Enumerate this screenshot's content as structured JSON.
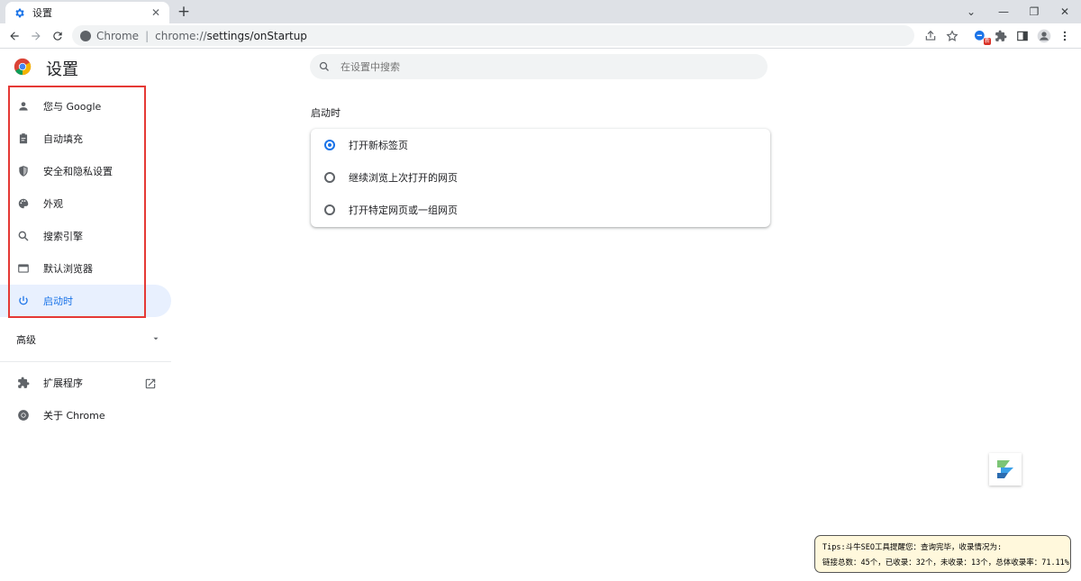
{
  "browser": {
    "tab_title": "设置",
    "omnibox": {
      "site_label": "Chrome",
      "separator": "|",
      "url_scheme": "chrome://",
      "url_path": "settings/onStartup"
    },
    "window_controls": {
      "dropdown": "⌄",
      "minimize": "—",
      "restore": "❐",
      "close": "✕"
    },
    "extension_badge": "新"
  },
  "settings": {
    "title": "设置",
    "search_placeholder": "在设置中搜索",
    "sidebar": {
      "items": [
        {
          "label": "您与 Google",
          "icon": "person-icon"
        },
        {
          "label": "自动填充",
          "icon": "clipboard-icon"
        },
        {
          "label": "安全和隐私设置",
          "icon": "shield-icon"
        },
        {
          "label": "外观",
          "icon": "palette-icon"
        },
        {
          "label": "搜索引擎",
          "icon": "search-icon"
        },
        {
          "label": "默认浏览器",
          "icon": "browser-window-icon"
        },
        {
          "label": "启动时",
          "icon": "power-icon",
          "selected": true
        }
      ],
      "advanced_label": "高级",
      "extensions_label": "扩展程序",
      "about_label": "关于 Chrome"
    },
    "startup": {
      "section_title": "启动时",
      "options": [
        {
          "label": "打开新标签页",
          "checked": true
        },
        {
          "label": "继续浏览上次打开的网页",
          "checked": false
        },
        {
          "label": "打开特定网页或一组网页",
          "checked": false
        }
      ]
    }
  },
  "tip": {
    "line1": "Tips:斗牛SEO工具提醒您：查询完毕，收录情况为:",
    "line2": "链接总数：45个，已收录：32个，未收录：13个，总体收录率：71.11%"
  },
  "colors": {
    "accent": "#1a73e8",
    "highlight_border": "#e53935",
    "selected_bg": "#e8f0fe"
  }
}
